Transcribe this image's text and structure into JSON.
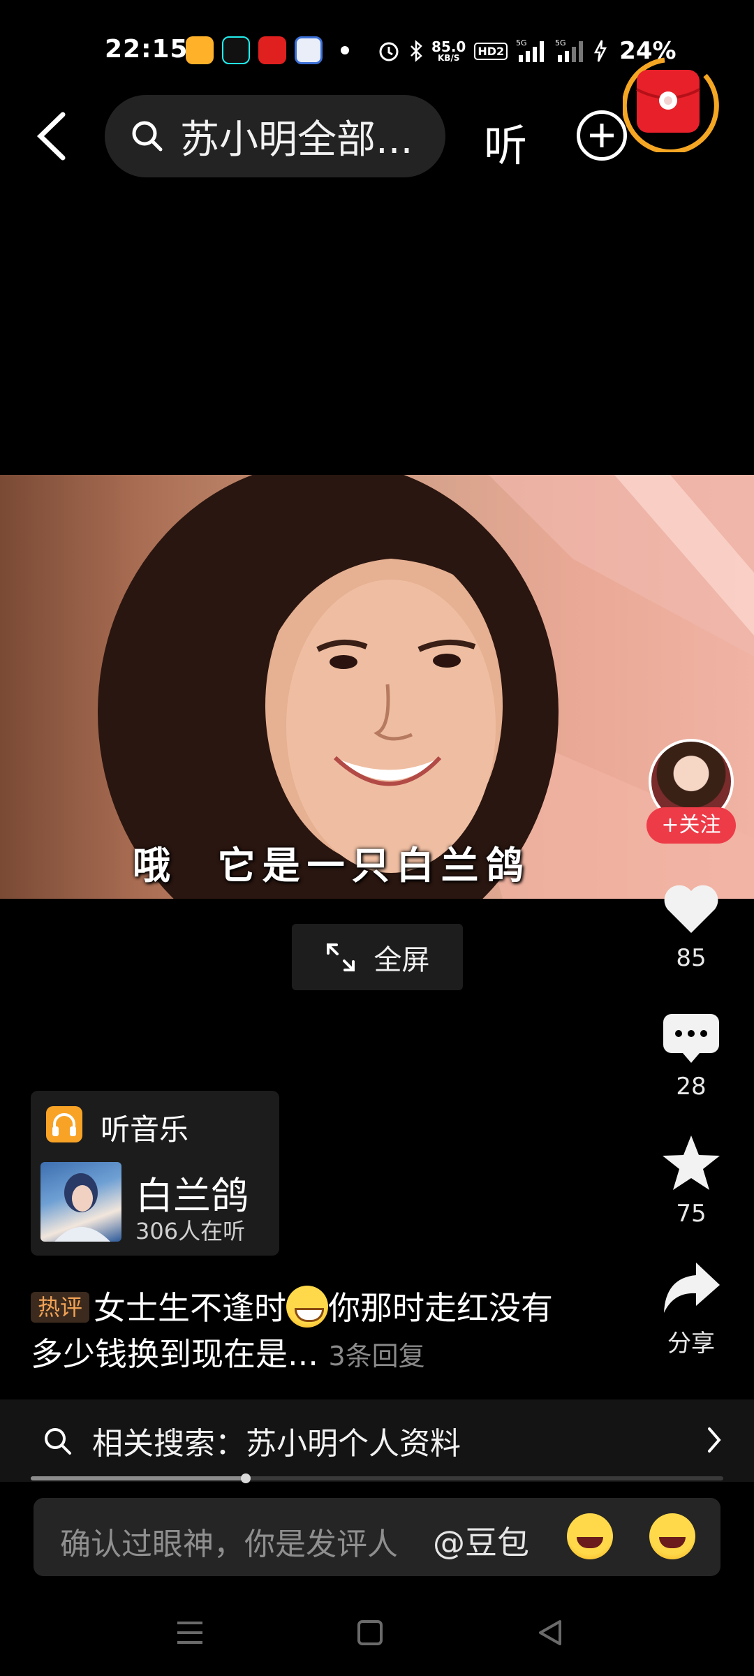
{
  "status_bar": {
    "time": "22:15",
    "net_speed_value": "85.0",
    "net_speed_unit": "KB/S",
    "hd_label": "HD2",
    "battery": "24%",
    "icons": [
      "weibo-icon",
      "tiktok-icon",
      "app-red-icon",
      "app-blue-icon",
      "dot-icon",
      "alarm-icon",
      "bluetooth-icon",
      "signal-5g-icon",
      "signal-5g-icon",
      "charging-icon"
    ]
  },
  "top_bar": {
    "search_query": "苏小明全部...",
    "listen_label": "听",
    "add_icon": "plus-circle-icon",
    "red_packet_icon": "red-packet-icon"
  },
  "video": {
    "subtitle": "哦  它是一只白兰鸽",
    "fullscreen_label": "全屏"
  },
  "rail": {
    "follow_label": "+关注",
    "likes": "85",
    "comments": "28",
    "favorites": "75",
    "share_label": "分享"
  },
  "music": {
    "card_title": "听音乐",
    "song_title": "白兰鸽",
    "listeners": "306人在听"
  },
  "hot_comment": {
    "badge": "热评",
    "text_part1": "女士生不逢时",
    "text_part2": "你那时走红没有多少钱换到现在是...",
    "reply_count": "3条回复"
  },
  "related_search": {
    "text": "相关搜索：苏小明个人资料",
    "progress": 0.31
  },
  "comment_input": {
    "placeholder": "确认过眼神，你是发评人",
    "mention": "@豆包"
  },
  "colors": {
    "accent_red": "#ee3b48",
    "music_orange": "#f8a326",
    "hot_badge_text": "#f1a256"
  }
}
